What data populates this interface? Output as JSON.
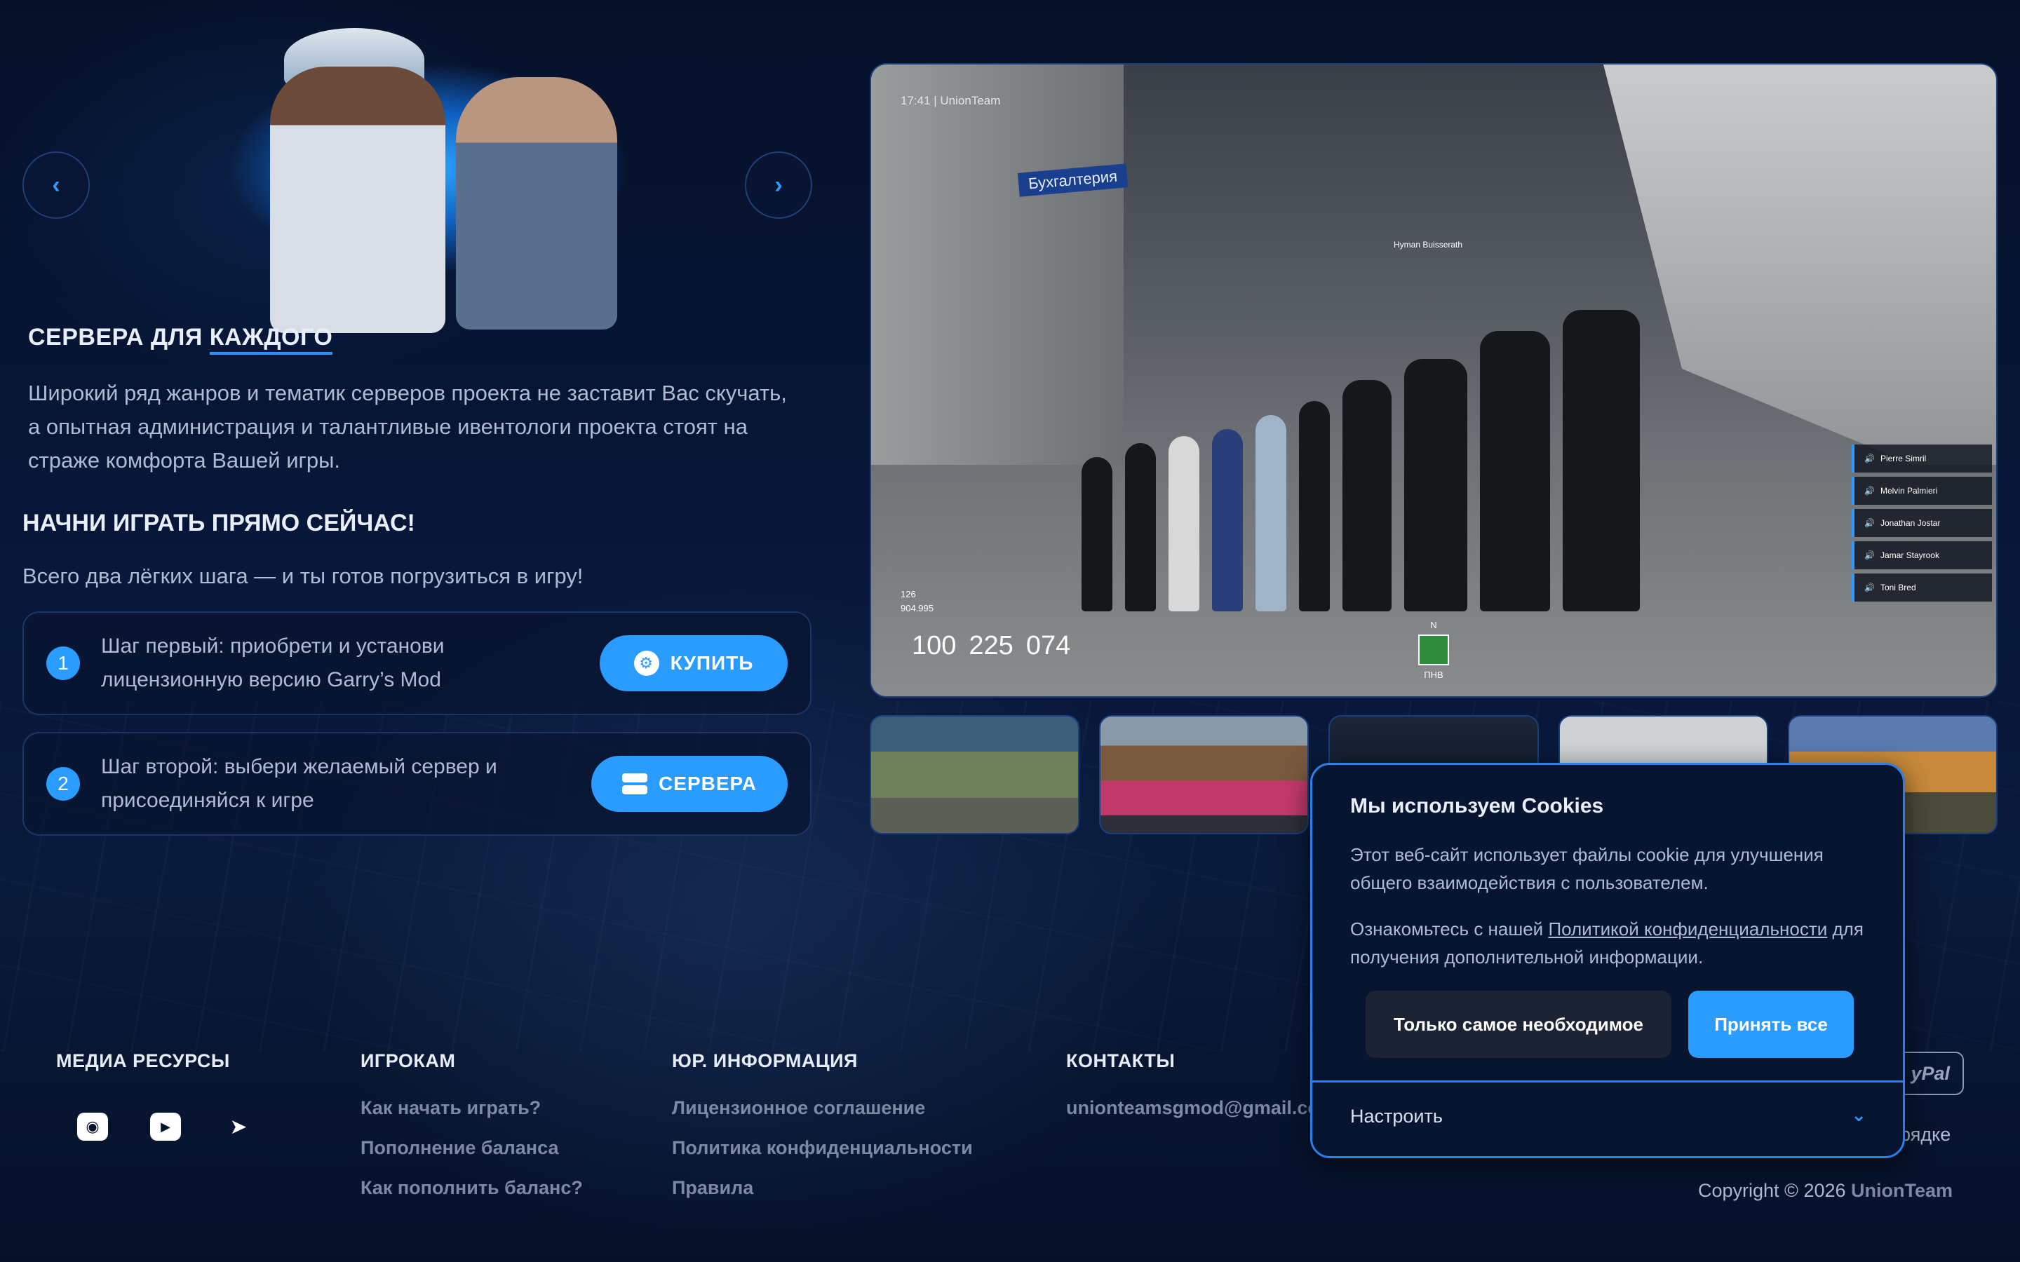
{
  "hero": {
    "title_prefix": "СЕРВЕРА ДЛЯ ",
    "title_accent": "КАЖДОГО",
    "description": "Широкий ряд жанров и тематик серверов проекта не заставит Вас скучать, а опытная администрация и талантливые ивентологи проекта стоят на страже комфорта Вашей игры.",
    "subtitle": "НАЧНИ ИГРАТЬ ПРЯМО СЕЙЧАС!",
    "lead": "Всего два лёгких шага — и ты готов погрузиться в игру!",
    "prev_icon": "chevron-left-icon",
    "next_icon": "chevron-right-icon",
    "steps": [
      {
        "number": "1",
        "text": "Шаг первый: приобрети и установи лицензионную версию Garry’s Mod",
        "button": "КУПИТЬ",
        "icon": "steam-icon"
      },
      {
        "number": "2",
        "text": "Шаг второй: выбери желаемый сервер и присоединяйся к игре",
        "button": "СЕРВЕРА",
        "icon": "server-icon"
      }
    ]
  },
  "screenshot": {
    "time": "17:41 | UnionTeam",
    "sign": "Бухгалтерия",
    "player_label": "Hyman Buisserath",
    "hud_lines": [
      "126",
      "904.995"
    ],
    "hud_numbers": [
      "100",
      "225",
      "074"
    ],
    "compass_top": "N",
    "compass_bottom": "ПНВ",
    "voice_list": [
      "Pierre Simril",
      "Melvin Palmieri",
      "Jonathan Jostar",
      "Jamar Stayrook",
      "Toni Bred"
    ]
  },
  "footer": {
    "media": {
      "heading": "МЕДИА РЕСУРСЫ",
      "icons": [
        "discord-icon",
        "youtube-icon",
        "telegram-icon"
      ]
    },
    "players": {
      "heading": "ИГРОКАМ",
      "links": [
        "Как начать играть?",
        "Пополнение баланса",
        "Как пополнить баланс?"
      ]
    },
    "legal": {
      "heading": "ЮР. ИНФОРМАЦИЯ",
      "links": [
        "Лицензионное соглашение",
        "Политика конфиденциальности",
        "Правила"
      ]
    },
    "contacts": {
      "heading": "КОНТАКТЫ",
      "email": "unionteamsgmod@gmail.co"
    },
    "paypal": "yPal",
    "order_text": "орядке",
    "copyright": "Copyright © 2026 ",
    "brand": "UnionTeam"
  },
  "cookie": {
    "title": "Мы используем Cookies",
    "text1": "Этот веб-сайт использует файлы cookie для улучшения общего взаимодействия с пользователем.",
    "text2_prefix": "Ознакомьтесь с нашей ",
    "text2_link": "Политикой конфиденциальности",
    "text2_suffix": " для получения дополнительной информации.",
    "btn_necessary": "Только самое необходимое",
    "btn_accept": "Принять все",
    "configure": "Настроить",
    "chevron_icon": "chevron-down-icon"
  },
  "colors": {
    "accent": "#2a9bff",
    "background": "#061330",
    "border": "#1b3568"
  }
}
